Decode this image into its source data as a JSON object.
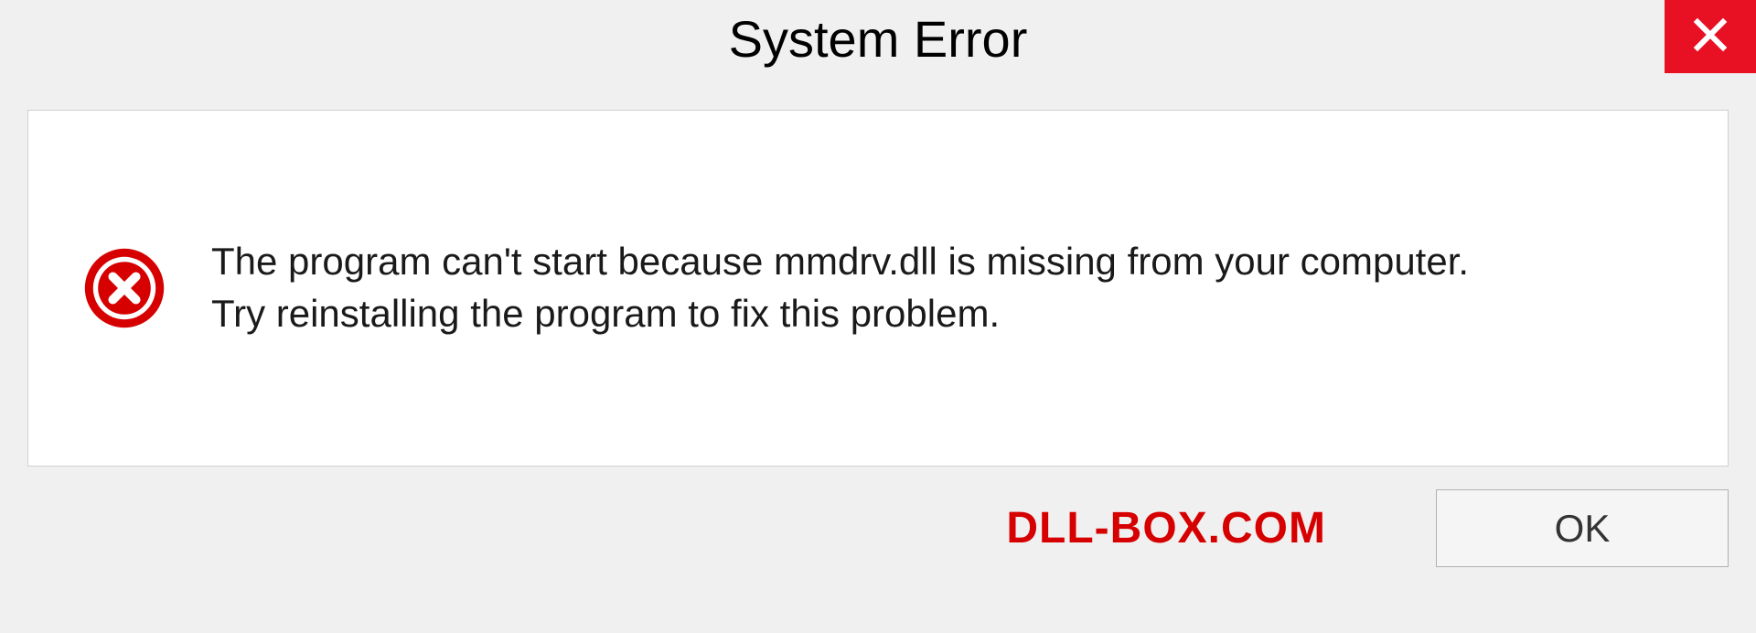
{
  "dialog": {
    "title": "System Error",
    "message_line1": "The program can't start because mmdrv.dll is missing from your computer.",
    "message_line2": "Try reinstalling the program to fix this problem.",
    "ok_label": "OK"
  },
  "watermark": "DLL-BOX.COM",
  "colors": {
    "close_button_bg": "#e81123",
    "error_icon_fill": "#d60000",
    "watermark_color": "#d60000"
  }
}
